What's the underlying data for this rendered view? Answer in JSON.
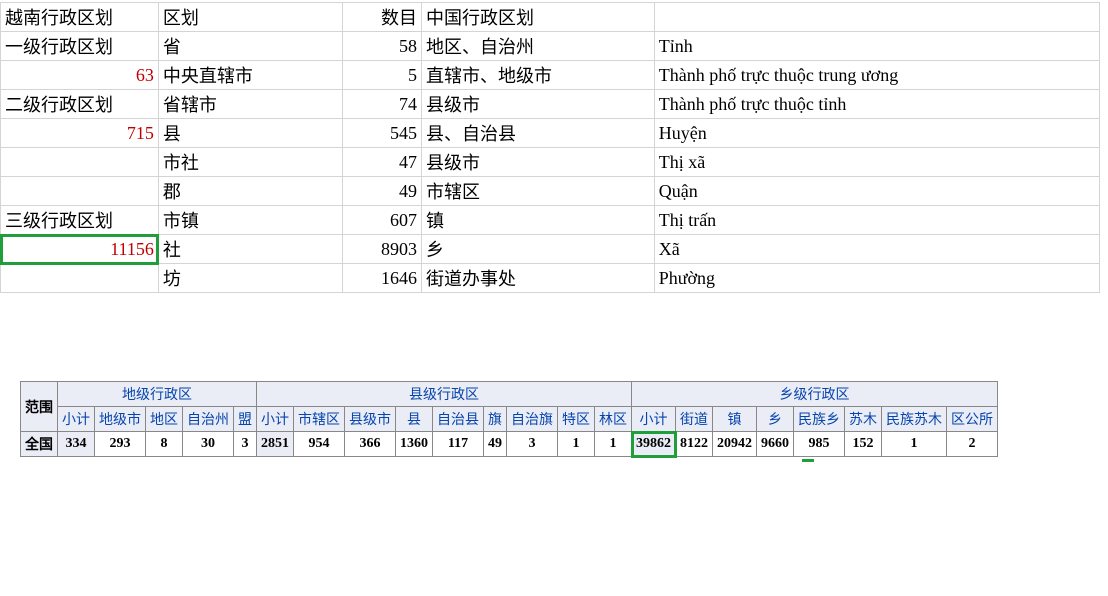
{
  "sheet": {
    "header": {
      "a": "越南行政区划",
      "b": "区划",
      "c": "数目",
      "d": "中国行政区划"
    },
    "rows": [
      {
        "a": "一级行政区划",
        "b": "省",
        "c": "58",
        "d": "地区、自治州",
        "e": "Tỉnh"
      },
      {
        "a": "63",
        "b": "中央直辖市",
        "c": "5",
        "d": "直辖市、地级市",
        "e": "Thành phố trực thuộc trung ương",
        "a_red": true
      },
      {
        "a": "二级行政区划",
        "b": "省辖市",
        "c": "74",
        "d": "县级市",
        "e": "Thành phố trực thuộc tỉnh"
      },
      {
        "a": "715",
        "b": "县",
        "c": "545",
        "d": "县、自治县",
        "e": "Huyện",
        "a_red": true
      },
      {
        "a": "",
        "b": "市社",
        "c": "47",
        "d": "县级市",
        "e": "Thị xã"
      },
      {
        "a": "",
        "b": "郡",
        "c": "49",
        "d": "市辖区",
        "e": "Quận"
      },
      {
        "a": "三级行政区划",
        "b": "市镇",
        "c": "607",
        "d": "镇",
        "e": "Thị trấn"
      },
      {
        "a": "11156",
        "b": "社",
        "c": "8903",
        "d": "乡",
        "e": "Xã",
        "a_red": true,
        "a_green": true
      },
      {
        "a": "",
        "b": "坊",
        "c": "1646",
        "d": "街道办事处",
        "e": "Phường"
      }
    ]
  },
  "stats": {
    "corner": "范围",
    "groups": [
      "地级行政区",
      "县级行政区",
      "乡级行政区"
    ],
    "cols_g1": [
      "小计",
      "地级市",
      "地区",
      "自治州",
      "盟"
    ],
    "cols_g2": [
      "小计",
      "市辖区",
      "县级市",
      "县",
      "自治县",
      "旗",
      "自治旗",
      "特区",
      "林区"
    ],
    "cols_g3": [
      "小计",
      "街道",
      "镇",
      "乡",
      "民族乡",
      "苏木",
      "民族苏木",
      "区公所"
    ],
    "row": {
      "label": "全国",
      "g1": [
        "334",
        "293",
        "8",
        "30",
        "3"
      ],
      "g2": [
        "2851",
        "954",
        "366",
        "1360",
        "117",
        "49",
        "3",
        "1",
        "1"
      ],
      "g3": [
        "39862",
        "8122",
        "20942",
        "9660",
        "985",
        "152",
        "1",
        "2"
      ]
    }
  }
}
